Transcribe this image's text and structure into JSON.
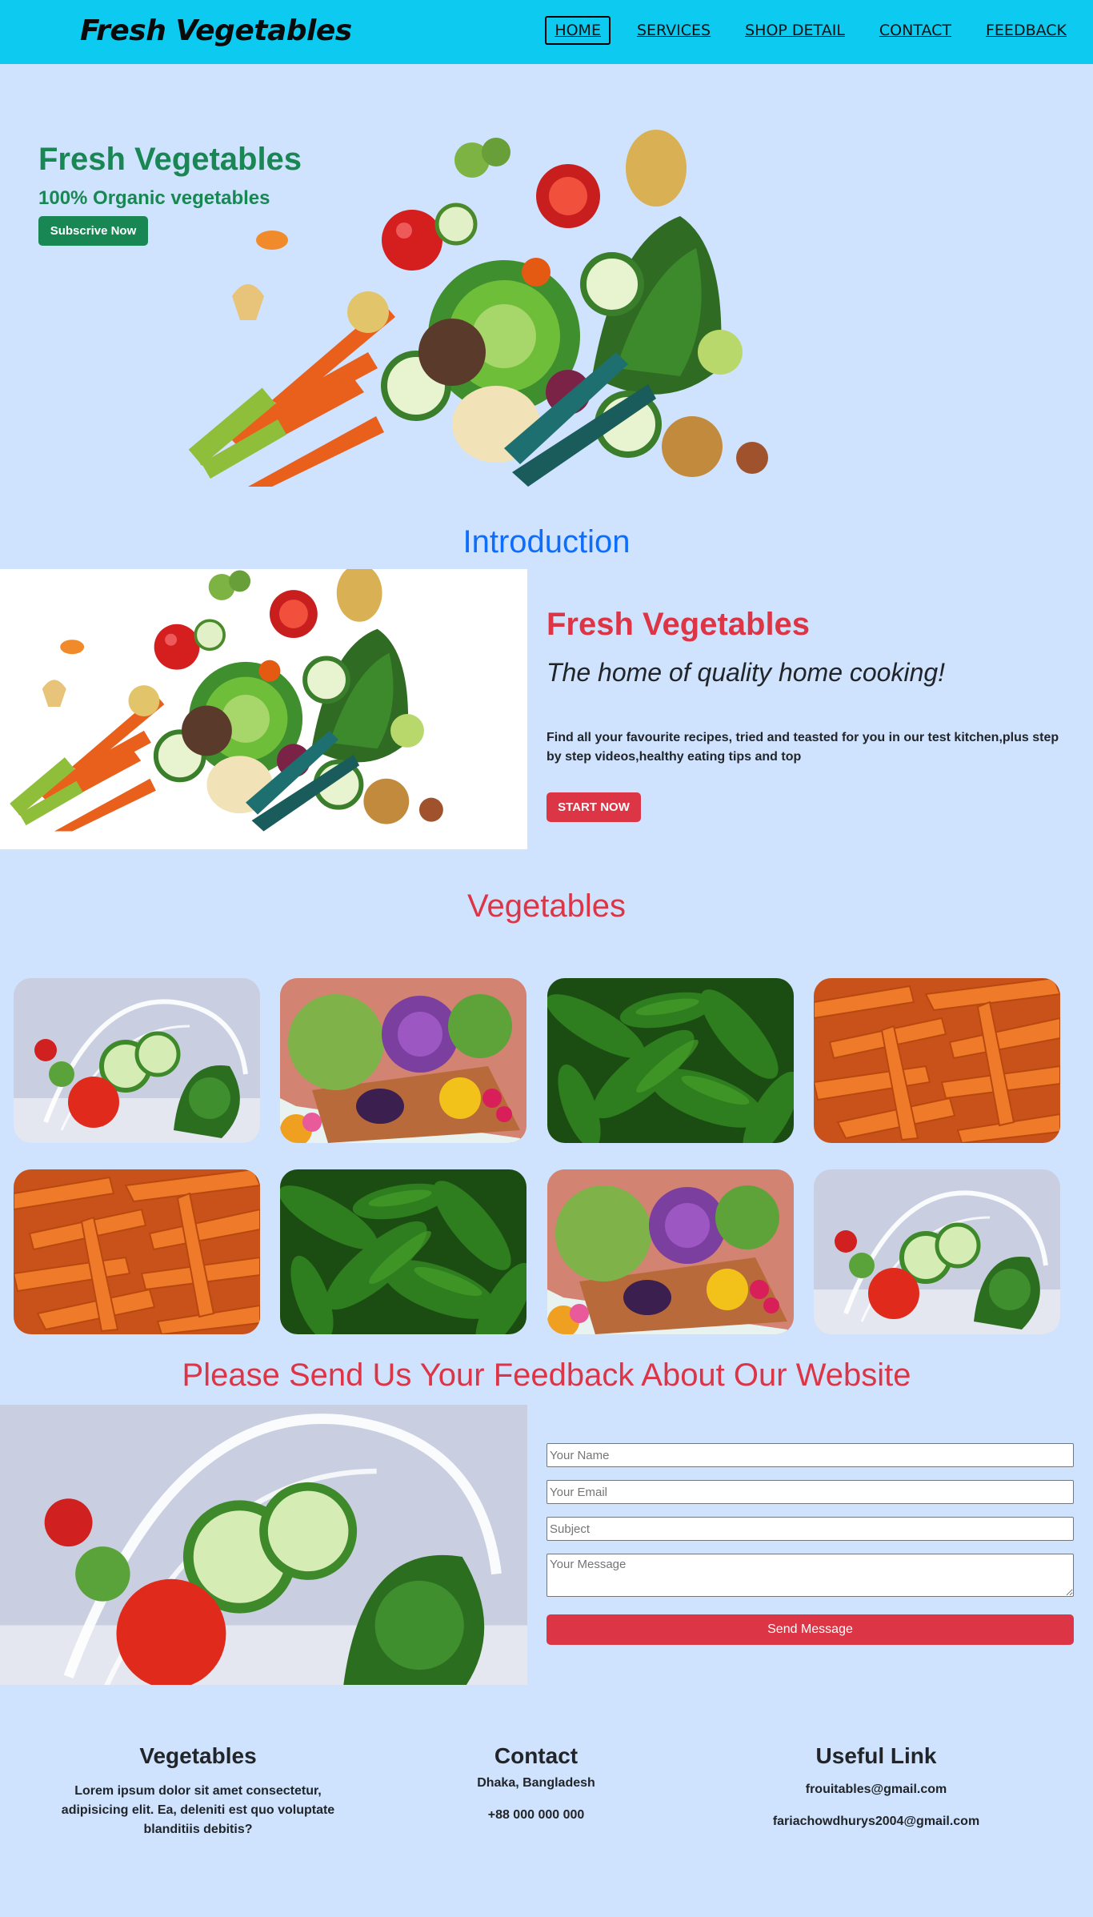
{
  "nav": {
    "brand": "Fresh Vegetables",
    "links": [
      "HOME",
      "SERVICES",
      "SHOP DETAIL",
      "CONTACT",
      "FEEDBACK"
    ]
  },
  "hero": {
    "title": "Fresh Vegetables",
    "subtitle": "100% Organic vegetables",
    "button": "Subscrive Now"
  },
  "intro": {
    "section_title": "Introduction",
    "heading": "Fresh Vegetables",
    "tagline": "The home of quality home cooking!",
    "text": "Find all your favourite recipes, tried and teasted for you in our test kitchen,plus step by step videos,healthy eating tips and top",
    "button": "START NOW"
  },
  "vegetables": {
    "section_title": "Vegetables",
    "images": [
      "splash",
      "basket",
      "cucumbers",
      "carrots",
      "carrots",
      "cucumbers",
      "basket",
      "splash"
    ]
  },
  "feedback": {
    "section_title": "Please Send Us Your Feedback About Our Website",
    "name_placeholder": "Your Name",
    "email_placeholder": "Your Email",
    "subject_placeholder": "Subject",
    "message_placeholder": "Your Message",
    "button": "Send Message"
  },
  "footer": {
    "col1_title": "Vegetables",
    "col1_text": "Lorem ipsum dolor sit amet consectetur, adipisicing elit. Ea, deleniti est quo voluptate blanditiis debitis?",
    "col2_title": "Contact",
    "col2_address": "Dhaka, Bangladesh",
    "col2_phone": "+88 000 000 000",
    "col3_title": "Useful Link",
    "col3_email1": "frouitables@gmail.com",
    "col3_email2": "fariachowdhurys2004@gmail.com"
  },
  "colors": {
    "navbar": "#0dcaf0",
    "page_bg": "#cfe2fe",
    "green": "#198754",
    "red": "#dc3545",
    "blue": "#0d6efd"
  }
}
